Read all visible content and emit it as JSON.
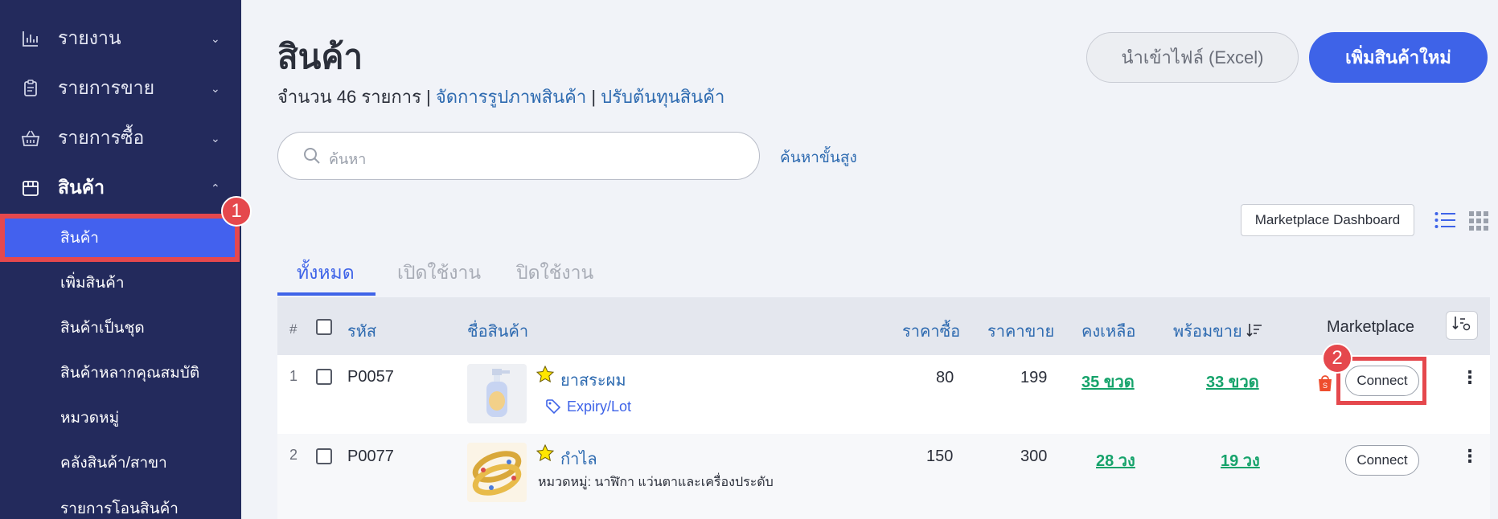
{
  "sidebar": {
    "groups": [
      {
        "label": "รายงาน",
        "chevron": "⌄",
        "icon": "bar-chart-icon"
      },
      {
        "label": "รายการขาย",
        "chevron": "⌄",
        "icon": "clipboard-icon"
      },
      {
        "label": "รายการซื้อ",
        "chevron": "⌄",
        "icon": "basket-icon"
      },
      {
        "label": "สินค้า",
        "chevron": "⌃",
        "icon": "box-icon"
      }
    ],
    "sub_items": [
      {
        "label": "สินค้า"
      },
      {
        "label": "เพิ่มสินค้า"
      },
      {
        "label": "สินค้าเป็นชุด"
      },
      {
        "label": "สินค้าหลากคุณสมบัติ"
      },
      {
        "label": "หมวดหมู่"
      },
      {
        "label": "คลังสินค้า/สาขา"
      },
      {
        "label": "รายการโอนสินค้า"
      }
    ]
  },
  "annotations": {
    "badge1": "1",
    "badge2": "2"
  },
  "header": {
    "title": "สินค้า",
    "count_text": "จำนวน 46 รายการ | ",
    "link_images": "จัดการรูปภาพสินค้า",
    "sep": " | ",
    "link_cost": "ปรับต้นทุนสินค้า",
    "import_button": "นำเข้าไฟล์ (Excel)",
    "add_button": "เพิ่มสินค้าใหม่"
  },
  "search": {
    "placeholder": "ค้นหา",
    "advanced": "ค้นหาขั้นสูง"
  },
  "toolbar": {
    "marketplace_dashboard": "Marketplace Dashboard"
  },
  "tabs": [
    {
      "label": "ทั้งหมด"
    },
    {
      "label": "เปิดใช้งาน"
    },
    {
      "label": "ปิดใช้งาน"
    }
  ],
  "table": {
    "columns": {
      "num": "#",
      "code": "รหัส",
      "name": "ชื่อสินค้า",
      "buy": "ราคาซื้อ",
      "sell": "ราคาขาย",
      "remain": "คงเหลือ",
      "ready": "พร้อมขาย",
      "marketplace": "Marketplace"
    },
    "rows": [
      {
        "num": "1",
        "code": "P0057",
        "name": "ยาสระผม",
        "tag": "Expiry/Lot",
        "buy": "80",
        "sell": "199",
        "remain": "35 ขวด",
        "ready": "33 ขวด",
        "connect": "Connect"
      },
      {
        "num": "2",
        "code": "P0077",
        "name": "กำไล",
        "category": "หมวดหมู่: นาฬิกา แว่นตาและเครื่องประดับ",
        "buy": "150",
        "sell": "300",
        "remain": "28 วง",
        "ready": "19 วง",
        "connect": "Connect"
      }
    ]
  },
  "colors": {
    "sidebar": "#232a5c",
    "accent": "#3e63e8",
    "highlight": "#e5484d",
    "stock_green": "#16a36b",
    "link": "#2d6ab0"
  }
}
